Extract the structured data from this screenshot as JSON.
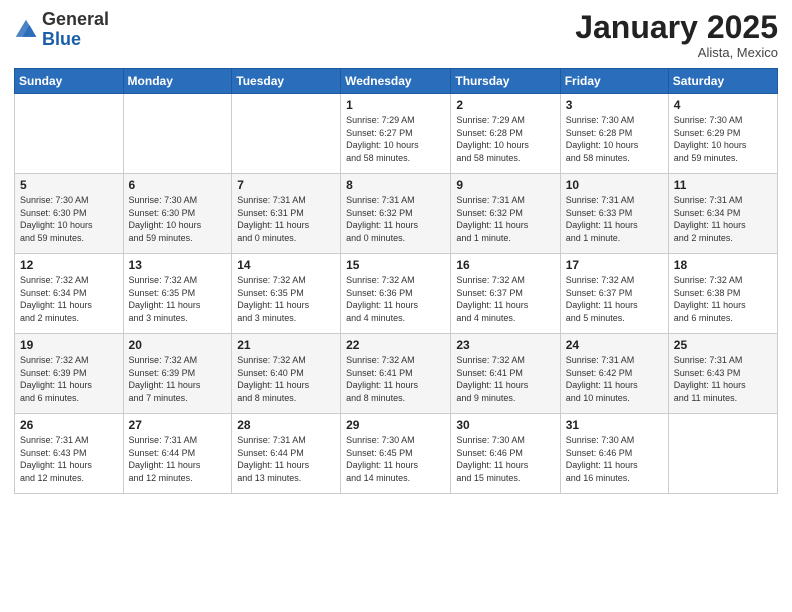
{
  "logo": {
    "general": "General",
    "blue": "Blue"
  },
  "header": {
    "month": "January 2025",
    "location": "Alista, Mexico"
  },
  "weekdays": [
    "Sunday",
    "Monday",
    "Tuesday",
    "Wednesday",
    "Thursday",
    "Friday",
    "Saturday"
  ],
  "weeks": [
    [
      {
        "day": "",
        "info": ""
      },
      {
        "day": "",
        "info": ""
      },
      {
        "day": "",
        "info": ""
      },
      {
        "day": "1",
        "info": "Sunrise: 7:29 AM\nSunset: 6:27 PM\nDaylight: 10 hours\nand 58 minutes."
      },
      {
        "day": "2",
        "info": "Sunrise: 7:29 AM\nSunset: 6:28 PM\nDaylight: 10 hours\nand 58 minutes."
      },
      {
        "day": "3",
        "info": "Sunrise: 7:30 AM\nSunset: 6:28 PM\nDaylight: 10 hours\nand 58 minutes."
      },
      {
        "day": "4",
        "info": "Sunrise: 7:30 AM\nSunset: 6:29 PM\nDaylight: 10 hours\nand 59 minutes."
      }
    ],
    [
      {
        "day": "5",
        "info": "Sunrise: 7:30 AM\nSunset: 6:30 PM\nDaylight: 10 hours\nand 59 minutes."
      },
      {
        "day": "6",
        "info": "Sunrise: 7:30 AM\nSunset: 6:30 PM\nDaylight: 10 hours\nand 59 minutes."
      },
      {
        "day": "7",
        "info": "Sunrise: 7:31 AM\nSunset: 6:31 PM\nDaylight: 11 hours\nand 0 minutes."
      },
      {
        "day": "8",
        "info": "Sunrise: 7:31 AM\nSunset: 6:32 PM\nDaylight: 11 hours\nand 0 minutes."
      },
      {
        "day": "9",
        "info": "Sunrise: 7:31 AM\nSunset: 6:32 PM\nDaylight: 11 hours\nand 1 minute."
      },
      {
        "day": "10",
        "info": "Sunrise: 7:31 AM\nSunset: 6:33 PM\nDaylight: 11 hours\nand 1 minute."
      },
      {
        "day": "11",
        "info": "Sunrise: 7:31 AM\nSunset: 6:34 PM\nDaylight: 11 hours\nand 2 minutes."
      }
    ],
    [
      {
        "day": "12",
        "info": "Sunrise: 7:32 AM\nSunset: 6:34 PM\nDaylight: 11 hours\nand 2 minutes."
      },
      {
        "day": "13",
        "info": "Sunrise: 7:32 AM\nSunset: 6:35 PM\nDaylight: 11 hours\nand 3 minutes."
      },
      {
        "day": "14",
        "info": "Sunrise: 7:32 AM\nSunset: 6:35 PM\nDaylight: 11 hours\nand 3 minutes."
      },
      {
        "day": "15",
        "info": "Sunrise: 7:32 AM\nSunset: 6:36 PM\nDaylight: 11 hours\nand 4 minutes."
      },
      {
        "day": "16",
        "info": "Sunrise: 7:32 AM\nSunset: 6:37 PM\nDaylight: 11 hours\nand 4 minutes."
      },
      {
        "day": "17",
        "info": "Sunrise: 7:32 AM\nSunset: 6:37 PM\nDaylight: 11 hours\nand 5 minutes."
      },
      {
        "day": "18",
        "info": "Sunrise: 7:32 AM\nSunset: 6:38 PM\nDaylight: 11 hours\nand 6 minutes."
      }
    ],
    [
      {
        "day": "19",
        "info": "Sunrise: 7:32 AM\nSunset: 6:39 PM\nDaylight: 11 hours\nand 6 minutes."
      },
      {
        "day": "20",
        "info": "Sunrise: 7:32 AM\nSunset: 6:39 PM\nDaylight: 11 hours\nand 7 minutes."
      },
      {
        "day": "21",
        "info": "Sunrise: 7:32 AM\nSunset: 6:40 PM\nDaylight: 11 hours\nand 8 minutes."
      },
      {
        "day": "22",
        "info": "Sunrise: 7:32 AM\nSunset: 6:41 PM\nDaylight: 11 hours\nand 8 minutes."
      },
      {
        "day": "23",
        "info": "Sunrise: 7:32 AM\nSunset: 6:41 PM\nDaylight: 11 hours\nand 9 minutes."
      },
      {
        "day": "24",
        "info": "Sunrise: 7:31 AM\nSunset: 6:42 PM\nDaylight: 11 hours\nand 10 minutes."
      },
      {
        "day": "25",
        "info": "Sunrise: 7:31 AM\nSunset: 6:43 PM\nDaylight: 11 hours\nand 11 minutes."
      }
    ],
    [
      {
        "day": "26",
        "info": "Sunrise: 7:31 AM\nSunset: 6:43 PM\nDaylight: 11 hours\nand 12 minutes."
      },
      {
        "day": "27",
        "info": "Sunrise: 7:31 AM\nSunset: 6:44 PM\nDaylight: 11 hours\nand 12 minutes."
      },
      {
        "day": "28",
        "info": "Sunrise: 7:31 AM\nSunset: 6:44 PM\nDaylight: 11 hours\nand 13 minutes."
      },
      {
        "day": "29",
        "info": "Sunrise: 7:30 AM\nSunset: 6:45 PM\nDaylight: 11 hours\nand 14 minutes."
      },
      {
        "day": "30",
        "info": "Sunrise: 7:30 AM\nSunset: 6:46 PM\nDaylight: 11 hours\nand 15 minutes."
      },
      {
        "day": "31",
        "info": "Sunrise: 7:30 AM\nSunset: 6:46 PM\nDaylight: 11 hours\nand 16 minutes."
      },
      {
        "day": "",
        "info": ""
      }
    ]
  ]
}
